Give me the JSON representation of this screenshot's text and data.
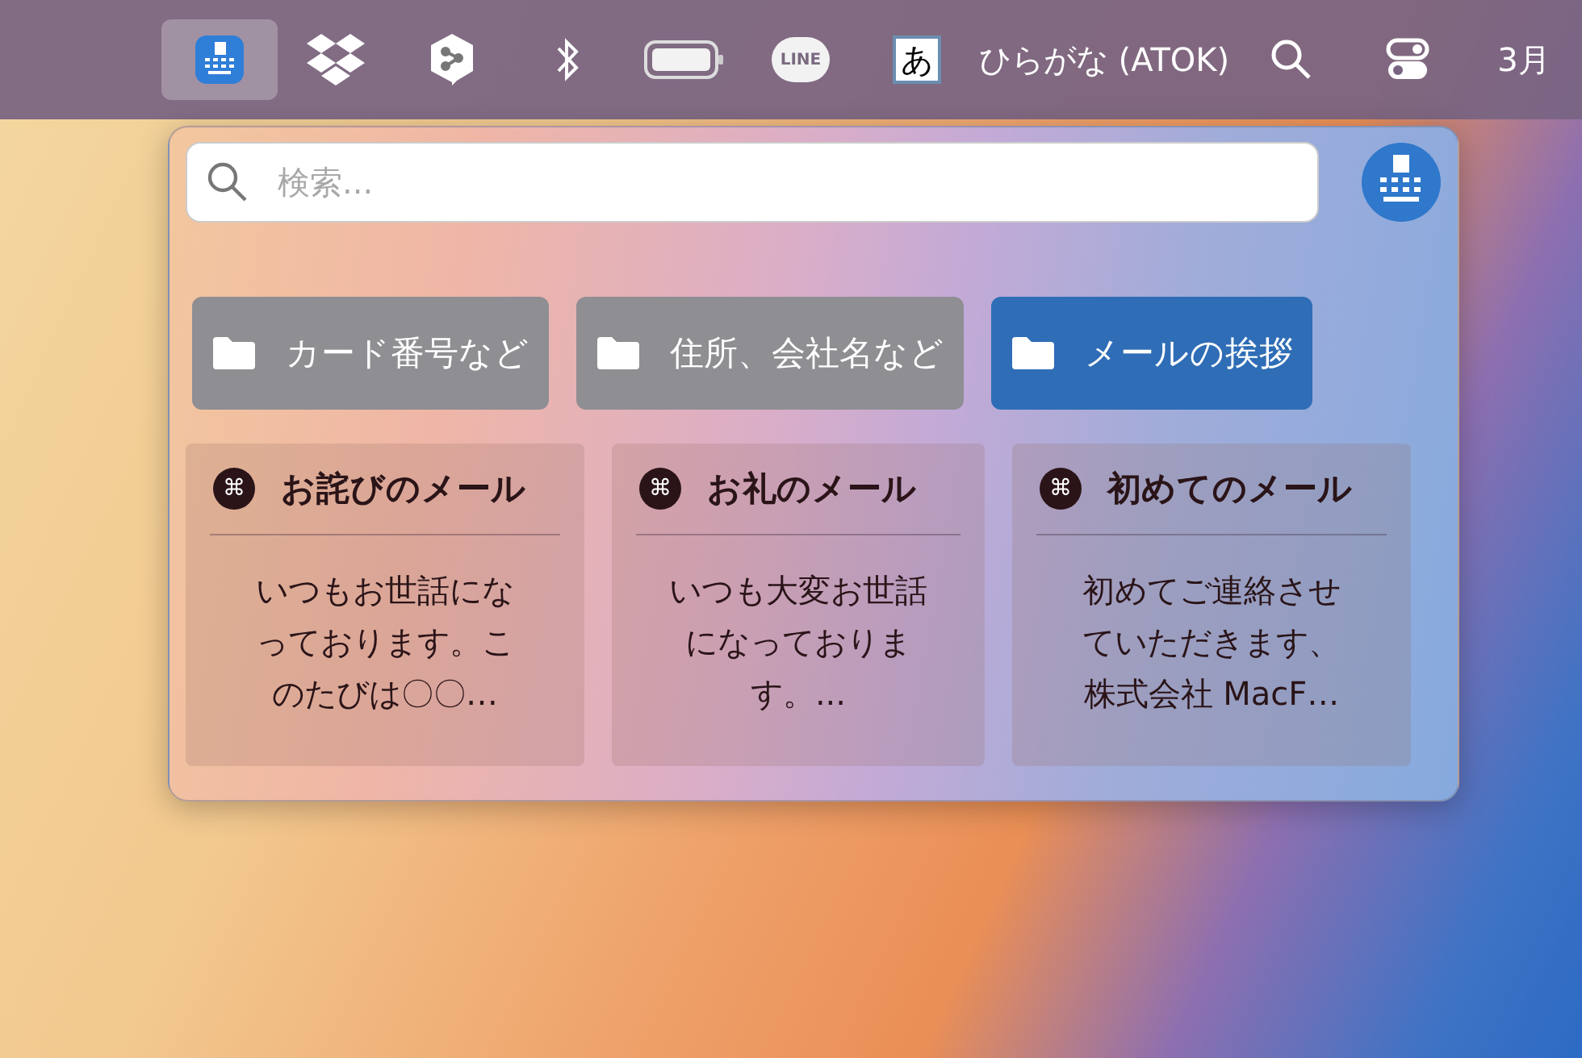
{
  "menu_bar": {
    "items": [
      {
        "kind": "keyboard-app",
        "selected": true
      },
      {
        "kind": "dropbox",
        "selected": false
      },
      {
        "kind": "deepl",
        "selected": false
      },
      {
        "kind": "bluetooth",
        "selected": false
      },
      {
        "kind": "battery",
        "selected": false
      },
      {
        "kind": "line",
        "label": "LINE",
        "selected": false
      },
      {
        "kind": "input-mode",
        "label": "あ",
        "selected": false
      },
      {
        "kind": "text",
        "label": "ひらがな (ATOK)",
        "selected": false
      },
      {
        "kind": "search",
        "selected": false
      },
      {
        "kind": "control-center",
        "selected": false
      },
      {
        "kind": "text",
        "label": "3月",
        "selected": false
      }
    ]
  },
  "popover": {
    "search": {
      "placeholder": "検索..."
    },
    "folders": [
      {
        "label": "カード番号など",
        "selected": false
      },
      {
        "label": "住所、会社名など",
        "selected": false
      },
      {
        "label": "メールの挨拶",
        "selected": true
      }
    ],
    "snippets": [
      {
        "icon": "⌘",
        "title": "お詫びのメール",
        "body": "いつもお世話になっております。このたびは〇〇…"
      },
      {
        "icon": "⌘",
        "title": "お礼のメール",
        "body": "いつも大変お世話になっております。..."
      },
      {
        "icon": "⌘",
        "title": "初めてのメール",
        "body": "初めてご連絡させていただきます、株式会社 MacF…"
      }
    ]
  }
}
